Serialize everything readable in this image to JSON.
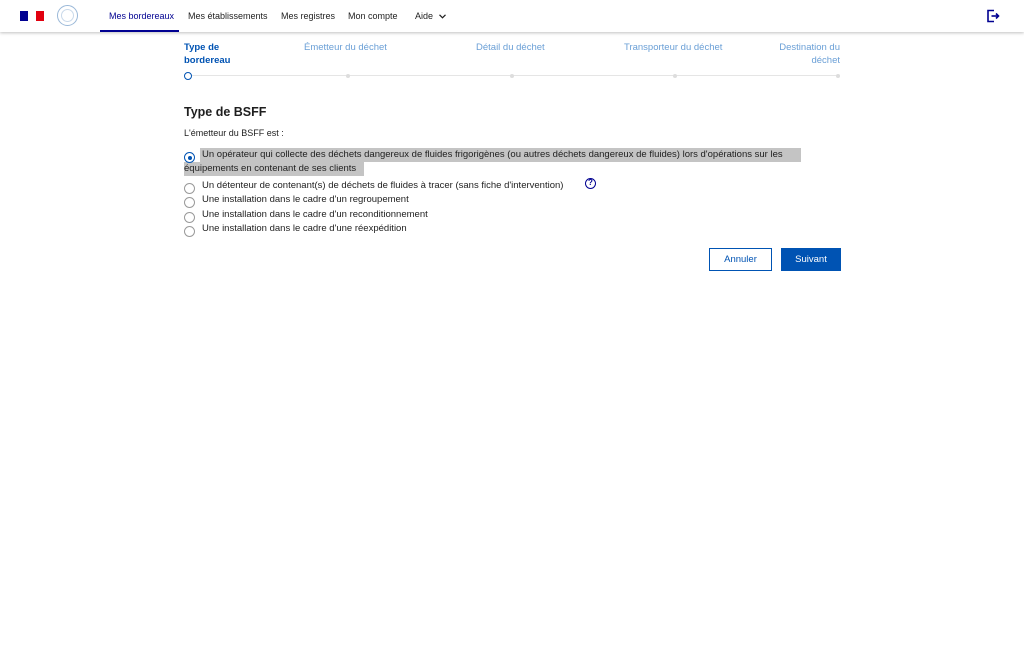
{
  "header": {
    "nav": [
      {
        "label": "Mes bordereaux",
        "active": true
      },
      {
        "label": "Mes établissements",
        "active": false
      },
      {
        "label": "Mes registres",
        "active": false
      },
      {
        "label": "Mon compte",
        "active": false
      },
      {
        "label": "Aide",
        "active": false,
        "has_dropdown": true
      }
    ],
    "logout_icon": "logout-icon",
    "chevron_icon": "chevron-down-icon"
  },
  "stepper": {
    "steps": [
      {
        "line1": "Type de",
        "line2": "bordereau",
        "active": true
      },
      {
        "line1": "Émetteur du déchet",
        "line2": "",
        "active": false
      },
      {
        "line1": "Détail du déchet",
        "line2": "",
        "active": false
      },
      {
        "line1": "Transporteur du déchet",
        "line2": "",
        "active": false
      },
      {
        "line1": "Destination du",
        "line2": "déchet",
        "active": false
      }
    ]
  },
  "form": {
    "title": "Type de BSFF",
    "question": "L'émetteur du BSFF est :",
    "options": [
      {
        "line1": "Un opérateur qui collecte des déchets dangereux de fluides frigorigènes (ou autres déchets dangereux de fluides) lors d'opérations sur les",
        "line2": "équipements en contenant de ses clients",
        "checked": true
      },
      {
        "line1": "Un détenteur de contenant(s) de déchets de fluides à tracer (sans fiche d'intervention)",
        "checked": false,
        "help": "?"
      },
      {
        "line1": "Une installation dans le cadre d'un regroupement",
        "checked": false
      },
      {
        "line1": "Une installation dans le cadre d'un reconditionnement",
        "checked": false
      },
      {
        "line1": "Une installation dans le cadre d'une réexpédition",
        "checked": false
      }
    ],
    "cancel_label": "Annuler",
    "next_label": "Suivant"
  },
  "colors": {
    "primary": "#000091",
    "action": "#0053b3",
    "step_inactive": "#6a9fd6",
    "highlight": "#c4c4c4"
  }
}
